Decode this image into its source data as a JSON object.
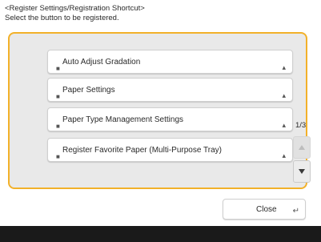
{
  "header": {
    "title": "<Register Settings/Registration Shortcut>",
    "instruction": "Select the button to be registered."
  },
  "options": [
    {
      "label": "Auto Adjust Gradation"
    },
    {
      "label": "Paper Settings"
    },
    {
      "label": "Paper Type Management Settings"
    },
    {
      "label": "Register Favorite Paper (Multi-Purpose Tray)"
    }
  ],
  "pagination": {
    "page": "1/3"
  },
  "footer": {
    "close_label": "Close"
  },
  "colors": {
    "selection_border": "#f2b12a",
    "bottom_bar": "#1a1a1a"
  },
  "icons": {
    "scroll_up": "triangle-up-icon",
    "scroll_down": "triangle-down-icon",
    "close": "return-arrow-icon"
  }
}
